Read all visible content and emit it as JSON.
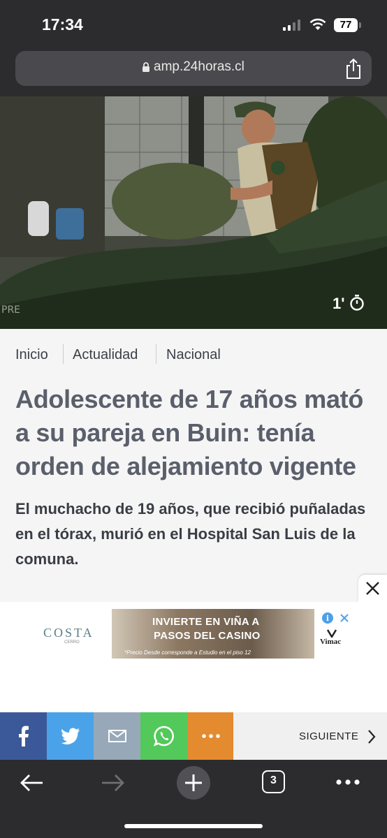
{
  "status_bar": {
    "time": "17:34",
    "battery": "77"
  },
  "browser": {
    "url": "amp.24horas.cl",
    "tab_count": "3"
  },
  "hero": {
    "duration": "1'"
  },
  "breadcrumb": [
    "Inicio",
    "Actualidad",
    "Nacional"
  ],
  "article": {
    "headline": "Adolescente de 17 años mató a su pareja en Buin: tenía orden de alejamiento vigente",
    "summary": "El muchacho de 19 años, que recibió puñaladas en el tórax, murió en el Hospital San Luis de la comuna."
  },
  "ad": {
    "brand": "COSTA",
    "brand_sub": "CERRO",
    "line1": "INVIERTE EN VIÑA A",
    "line2": "PASOS DEL CASINO",
    "fine_print": "*Precio Desde corresponde a Estudio en el piso 12",
    "advertiser": "Vimac"
  },
  "share": {
    "next_label": "SIGUIENTE",
    "buttons": [
      {
        "icon": "facebook-icon",
        "color": "#3b5998"
      },
      {
        "icon": "twitter-icon",
        "color": "#4aa3e8"
      },
      {
        "icon": "email-icon",
        "color": "#97a9b8"
      },
      {
        "icon": "whatsapp-icon",
        "color": "#52c95a"
      },
      {
        "icon": "more-icon",
        "color": "#e48a2f"
      }
    ]
  },
  "colors": {
    "chrome": "#2c2c2e",
    "headline": "#5a5f6b"
  }
}
